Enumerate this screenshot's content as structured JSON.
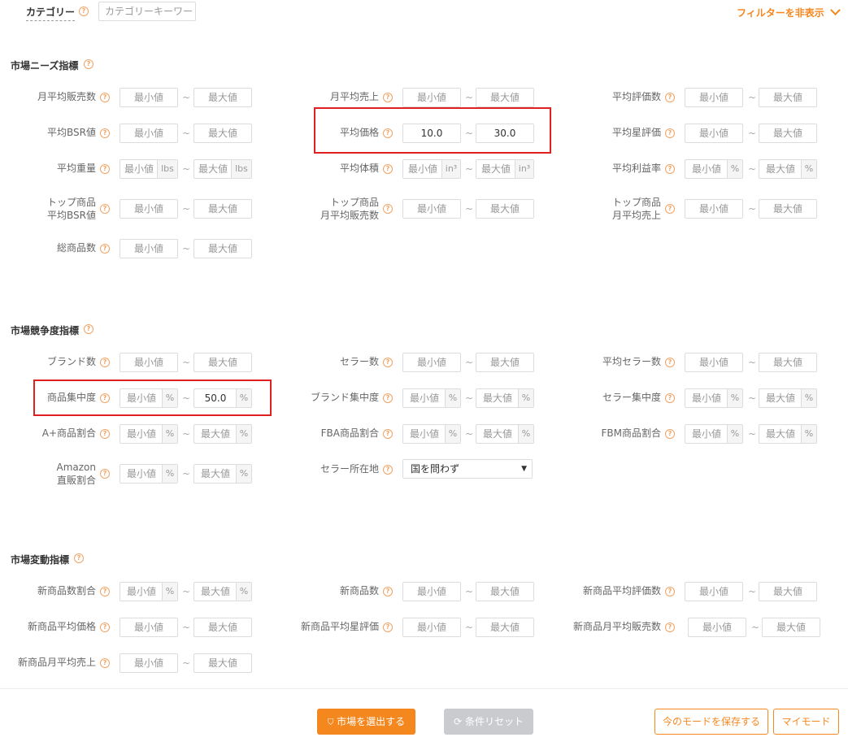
{
  "header": {
    "category_label": "カテゴリー",
    "category_placeholder": "カテゴリーキーワー",
    "toggle_filter_label": "フィルターを非表示"
  },
  "sections": {
    "needs": {
      "title": "市場ニーズ指標"
    },
    "competition": {
      "title": "市場競争度指標"
    },
    "trend": {
      "title": "市場変動指標"
    }
  },
  "placeholders": {
    "min": "最小値",
    "max": "最大値"
  },
  "units": {
    "lbs": "lbs",
    "in3": "in³",
    "pct": "%"
  },
  "tilde": "~",
  "fields": {
    "monthly_avg_sales_qty": {
      "label": "月平均販売数"
    },
    "monthly_avg_revenue": {
      "label": "月平均売上"
    },
    "avg_review_count": {
      "label": "平均評価数"
    },
    "avg_bsr": {
      "label": "平均BSR値"
    },
    "avg_price": {
      "label": "平均価格",
      "min_value": "10.0",
      "max_value": "30.0"
    },
    "avg_star_rating": {
      "label": "平均星評価"
    },
    "avg_weight": {
      "label": "平均重量"
    },
    "avg_volume": {
      "label": "平均体積"
    },
    "avg_profit_margin": {
      "label": "平均利益率"
    },
    "top_avg_bsr": {
      "label_line1": "トップ商品",
      "label_line2": "平均BSR値"
    },
    "top_monthly_sales_qty": {
      "label_line1": "トップ商品",
      "label_line2": "月平均販売数"
    },
    "top_monthly_revenue": {
      "label_line1": "トップ商品",
      "label_line2": "月平均売上"
    },
    "total_products": {
      "label": "総商品数"
    },
    "brand_count": {
      "label": "ブランド数"
    },
    "seller_count": {
      "label": "セラー数"
    },
    "avg_seller_count": {
      "label": "平均セラー数"
    },
    "product_concentration": {
      "label": "商品集中度",
      "max_value": "50.0"
    },
    "brand_concentration": {
      "label": "ブランド集中度"
    },
    "seller_concentration": {
      "label": "セラー集中度"
    },
    "aplus_ratio": {
      "label": "A+商品割合"
    },
    "fba_ratio": {
      "label": "FBA商品割合"
    },
    "fbm_ratio": {
      "label": "FBM商品割合"
    },
    "amazon_direct_ratio": {
      "label_line1": "Amazon",
      "label_line2": "直販割合"
    },
    "seller_location": {
      "label": "セラー所在地",
      "selected": "国を問わず"
    },
    "new_product_ratio": {
      "label": "新商品数割合"
    },
    "new_product_count": {
      "label": "新商品数"
    },
    "new_avg_review_count": {
      "label": "新商品平均評価数"
    },
    "new_avg_price": {
      "label": "新商品平均価格"
    },
    "new_avg_star_rating": {
      "label": "新商品平均星評価"
    },
    "new_monthly_sales_qty": {
      "label": "新商品月平均販売数"
    },
    "new_monthly_revenue": {
      "label": "新商品月平均売上"
    }
  },
  "footer": {
    "select_market_button": "市場を選出する",
    "reset_button": "条件リセット",
    "save_mode_button": "今のモードを保存する",
    "my_mode_button": "マイモード"
  },
  "colors": {
    "accent": "#f5871f",
    "highlight_border": "#e02020",
    "help_icon": "#f3a262"
  }
}
